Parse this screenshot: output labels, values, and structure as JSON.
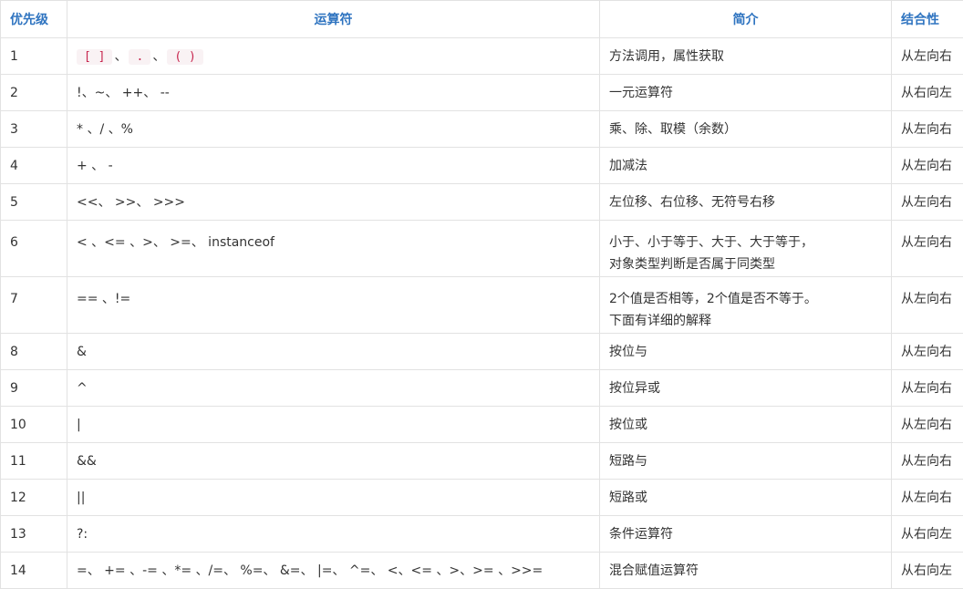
{
  "table": {
    "headers": [
      "优先级",
      "运算符",
      "简介",
      "结合性"
    ],
    "row1": {
      "priority": "1",
      "code1": "[ ]",
      "sep1": "、",
      "code2": ".",
      "sep2": "、",
      "code3": "( )",
      "desc": "方法调用，属性获取",
      "assoc": "从左向右"
    },
    "rows": [
      {
        "priority": "2",
        "operators": "!、~、 ++、 --",
        "desc": "一元运算符",
        "desc2": "",
        "assoc": "从右向左"
      },
      {
        "priority": "3",
        "operators": "* 、/ 、%",
        "desc": "乘、除、取模（余数）",
        "desc2": "",
        "assoc": "从左向右"
      },
      {
        "priority": "4",
        "operators": "+ 、 -",
        "desc": "加减法",
        "desc2": "",
        "assoc": "从左向右"
      },
      {
        "priority": "5",
        "operators": "<<、 >>、 >>>",
        "desc": "左位移、右位移、无符号右移",
        "desc2": "",
        "assoc": "从左向右"
      },
      {
        "priority": "6",
        "operators": "< 、<= 、>、 >=、 instanceof",
        "desc": "小于、小于等于、大于、大于等于，",
        "desc2": "对象类型判断是否属于同类型",
        "assoc": "从左向右"
      },
      {
        "priority": "7",
        "operators": "== 、!=",
        "desc": "2个值是否相等，2个值是否不等于。",
        "desc2": "下面有详细的解释",
        "assoc": "从左向右"
      },
      {
        "priority": "8",
        "operators": "&",
        "desc": "按位与",
        "desc2": "",
        "assoc": "从左向右"
      },
      {
        "priority": "9",
        "operators": "^",
        "desc": "按位异或",
        "desc2": "",
        "assoc": "从左向右"
      },
      {
        "priority": "10",
        "operators": "|",
        "desc": "按位或",
        "desc2": "",
        "assoc": "从左向右"
      },
      {
        "priority": "11",
        "operators": "&&",
        "desc": "短路与",
        "desc2": "",
        "assoc": "从左向右"
      },
      {
        "priority": "12",
        "operators": "||",
        "desc": "短路或",
        "desc2": "",
        "assoc": "从左向右"
      },
      {
        "priority": "13",
        "operators": "?:",
        "desc": "条件运算符",
        "desc2": "",
        "assoc": "从右向左"
      },
      {
        "priority": "14",
        "operators": "=、 += 、-= 、*= 、/=、 %=、 &=、 |=、 ^=、 <、<= 、>、>= 、>>=",
        "desc": "混合赋值运算符",
        "desc2": "",
        "assoc": "从右向左"
      }
    ]
  }
}
